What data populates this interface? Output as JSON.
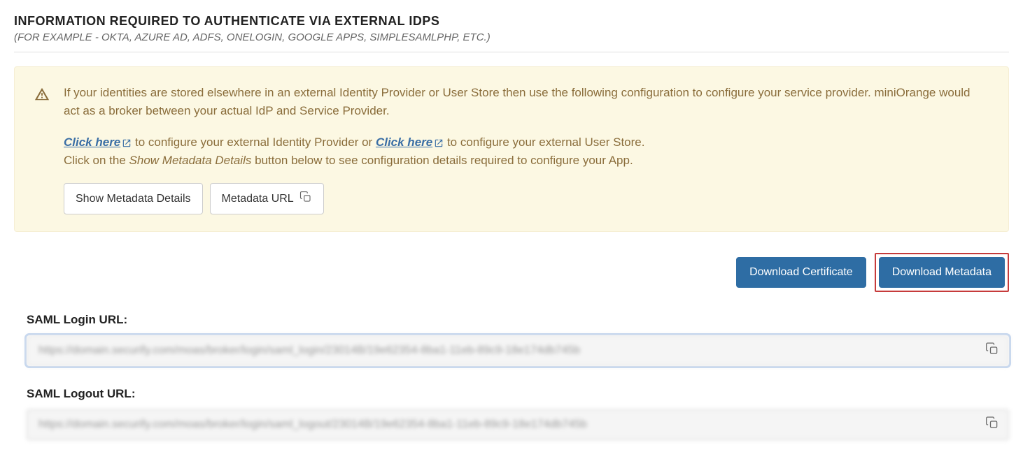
{
  "header": {
    "title": "INFORMATION REQUIRED TO AUTHENTICATE VIA EXTERNAL IDPS",
    "subtitle": "(FOR EXAMPLE - OKTA, AZURE AD, ADFS, ONELOGIN, GOOGLE APPS, SIMPLESAMLPHP, ETC.)"
  },
  "alert": {
    "paragraph1": "If your identities are stored elsewhere in an external Identity Provider or User Store then use the following configuration to configure your service provider. miniOrange would act as a broker between your actual IdP and Service Provider.",
    "click_here": "Click here",
    "idp_text": " to configure your external Identity Provider or ",
    "userstore_text": " to configure your external User Store.",
    "line3_prefix": "Click on the ",
    "line3_italic": "Show Metadata Details",
    "line3_suffix": " button below to see configuration details required to configure your App."
  },
  "buttons": {
    "show_metadata": "Show Metadata Details",
    "metadata_url": "Metadata URL",
    "download_cert": "Download Certificate",
    "download_meta": "Download Metadata"
  },
  "fields": {
    "saml_login": {
      "label": "SAML Login URL:",
      "value": "https://domain.securify.com/moas/broker/login/saml_login/23014B/19e62354-8ba1-11eb-89c9-18e174db745b"
    },
    "saml_logout": {
      "label": "SAML Logout URL:",
      "value": "https://domain.securify.com/moas/broker/login/saml_logout/23014B/19e62354-8ba1-11eb-89c9-18e174db745b"
    }
  }
}
